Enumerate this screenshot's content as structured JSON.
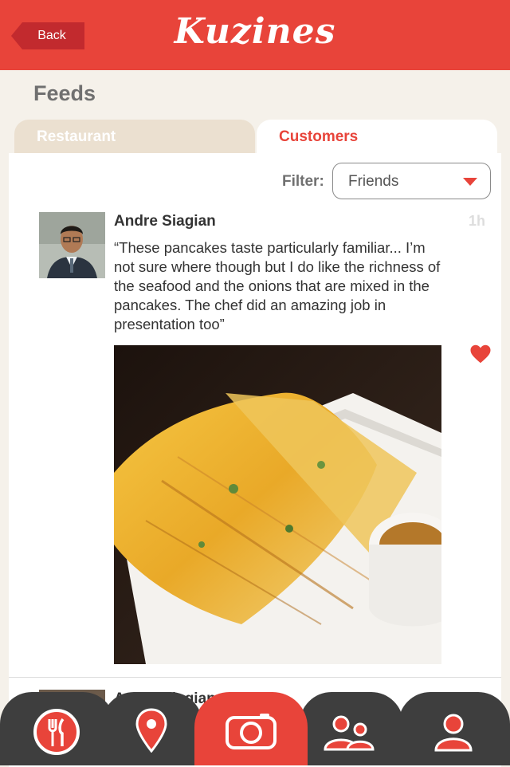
{
  "header": {
    "back_label": "Back",
    "logo_text": "Kuzines"
  },
  "page_title": "Feeds",
  "tabs": [
    {
      "label": "Restaurant",
      "active": false
    },
    {
      "label": "Customers",
      "active": true
    }
  ],
  "filter": {
    "label": "Filter:",
    "selected": "Friends"
  },
  "post": {
    "author": "Andre Siagian",
    "time": "1h",
    "text": "“These pancakes taste particularly familiar... I’m not sure where though but I do like the richness of the seafood and the onions that are mixed in the pancakes. The chef did an amazing job in presentation too”",
    "liked": true
  },
  "next_post": {
    "author": "Andre Siagian"
  },
  "bottom_nav": [
    {
      "icon": "fork-knife-icon"
    },
    {
      "icon": "map-pin-icon"
    },
    {
      "icon": "camera-icon",
      "active": true
    },
    {
      "icon": "friends-icon"
    },
    {
      "icon": "profile-icon"
    }
  ],
  "colors": {
    "brand": "#e8443a",
    "dark_nav": "#3e3e3e"
  }
}
